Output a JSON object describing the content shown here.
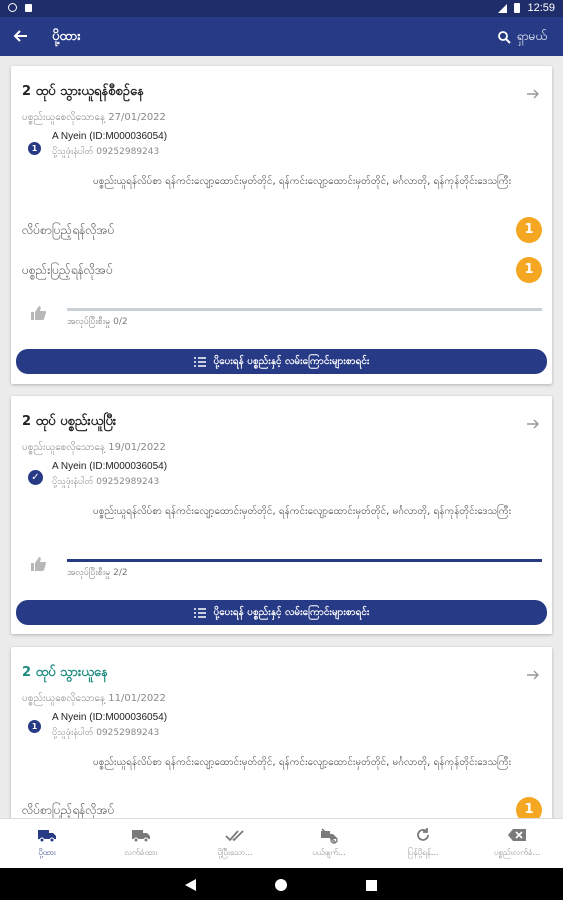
{
  "status_bar": {
    "time": "12:59"
  },
  "app_bar": {
    "title": "ပို့ထား",
    "search_label": "ရှာမယ်"
  },
  "cards": [
    {
      "title": "2 ထုပ် သွားယူရန်စီစဉ်နေ",
      "title_color": "dark",
      "date": "ပစ္စည်းယူစေလိုသောနေ့ 27/01/2022",
      "step": "1",
      "step_state": "number",
      "person": "A Nyein (ID:M000036054)",
      "phone": "ပို့သူဖုံးနံပါတ် 09252989243",
      "address": "ပစ္စည်းယူရန်လိပ်စာ ရန်ကင်းလျော့ထောင်းမှတ်တိုင်, ရန်ကင်းလျော့ထောင်းမှတ်တိုင်, မင်္ဂလာတို, ရန်ကုန်တိုင်းဒေသကြီး",
      "rows": [
        {
          "label": "လိပ်စာပြည့်ရန်လိုအပ်",
          "count": "1"
        },
        {
          "label": "ပစ္စည်းပြည့်ရန်လိုအပ်",
          "count": "1"
        }
      ],
      "progress_text": "အလုပ်ပြီးစီးမှု 0/2",
      "progress": 0.0,
      "button_label": "ပို့ပေးရန် ပစ္စည်းနှင့် လမ်းကြောင်းများစာရင်း"
    },
    {
      "title": "2 ထုပ် ပစ္စည်းယူပြီး",
      "title_color": "dark",
      "date": "ပစ္စည်းယူစေလိုသောနေ့ 19/01/2022",
      "step": "✓",
      "step_state": "check",
      "person": "A Nyein (ID:M000036054)",
      "phone": "ပို့သူဖုံးနံပါတ် 09252989243",
      "address": "ပစ္စည်းယူရန်လိပ်စာ ရန်ကင်းလျော့ထောင်းမှတ်တိုင်, ရန်ကင်းလျော့ထောင်းမှတ်တိုင်, မင်္ဂလာတို, ရန်ကုန်တိုင်းဒေသကြီး",
      "rows": [],
      "progress_text": "အလုပ်ပြီးစီးမှု 2/2",
      "progress": 1.0,
      "button_label": "ပို့ပေးရန် ပစ္စည်းနှင့် လမ်းကြောင်းများစာရင်း"
    },
    {
      "title": "2 ထုပ် သွားယူနေ",
      "title_color": "teal",
      "date": "ပစ္စည်းယူစေလိုသောနေ့ 11/01/2022",
      "step": "1",
      "step_state": "number",
      "person": "A Nyein (ID:M000036054)",
      "phone": "ပို့သူဖုံးနံပါတ် 09252989243",
      "address": "ပစ္စည်းယူရန်လိပ်စာ ရန်ကင်းလျော့ထောင်းမှတ်တိုင်, ရန်ကင်းလျော့ထောင်းမှတ်တိုင်, မင်္ဂလာတို, ရန်ကုန်တိုင်းဒေသကြီး",
      "rows": [
        {
          "label": "လိပ်စာပြည့်ရန်လိုအပ်",
          "count": "1"
        }
      ]
    }
  ],
  "bottom_nav": [
    {
      "label": "ပို့ထား",
      "icon": "truck-icon",
      "active": true
    },
    {
      "label": "လက်ခံထား",
      "icon": "truck-icon",
      "active": false
    },
    {
      "label": "ပို့ပြီးသော...",
      "icon": "double-check-icon",
      "active": false
    },
    {
      "label": "ပယ်ဖျက်...",
      "icon": "truck-cancel-icon",
      "active": false
    },
    {
      "label": "ပြန်ပို့ရန်...",
      "icon": "refresh-icon",
      "active": false
    },
    {
      "label": "ပစ္စည်းလက်ခံ...",
      "icon": "backspace-icon",
      "active": false
    }
  ],
  "colors": {
    "primary": "#273a86",
    "accent": "#f5a623",
    "teal": "#1a8a7e"
  }
}
